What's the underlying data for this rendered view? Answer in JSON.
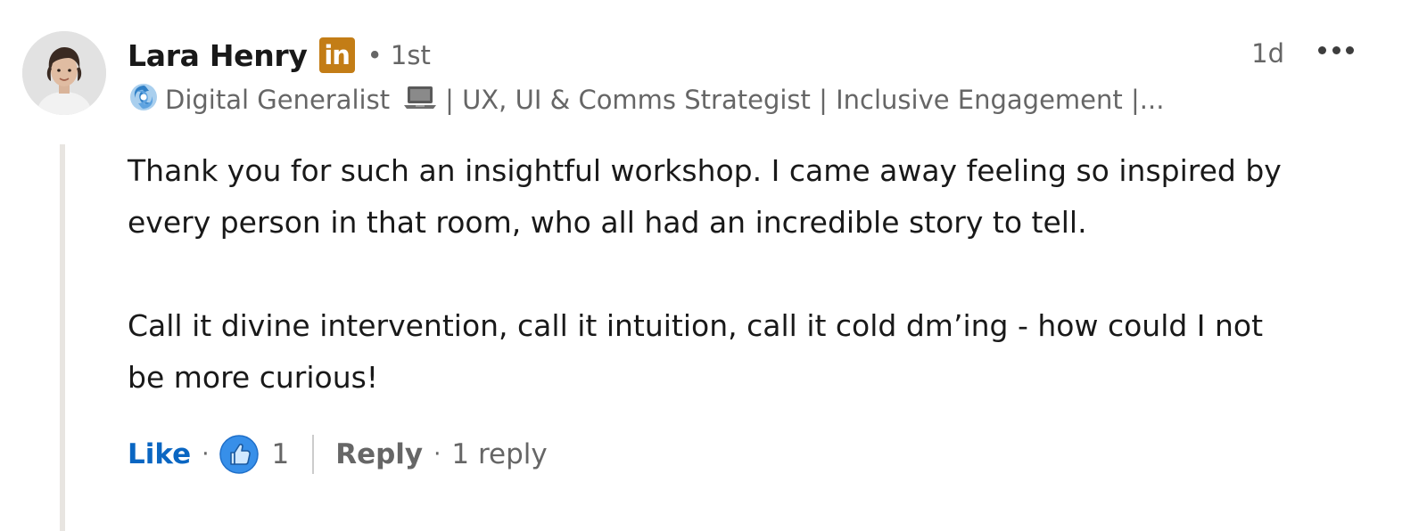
{
  "comment": {
    "author": {
      "name": "Lara Henry",
      "badge_text": "in",
      "connection_degree": "• 1st",
      "headline_start": "Digital Generalist",
      "headline_rest": "| UX, UI & Comms Strategist | Inclusive Engagement |..."
    },
    "timestamp": "1d",
    "body": {
      "paragraph_1_line_1": "Thank you for such an insightful workshop. I came away feeling so inspired by",
      "paragraph_1_line_2": "every person in that room, who all had an incredible story to tell.",
      "paragraph_2_line_1": "Call it divine intervention, call it intuition, call it cold dm’ing - how could I not",
      "paragraph_2_line_2": "be more curious!"
    },
    "actions": {
      "like_label": "Like",
      "separator": "·",
      "like_count": "1",
      "reply_label": "Reply",
      "replies_text": "1 reply"
    }
  },
  "icons": {
    "badge": "linkedin-badge-icon",
    "headline_emoji_1": "hurricane-icon",
    "headline_emoji_2": "laptop-icon",
    "more": "more-options-icon",
    "reaction": "thumbs-up-icon"
  },
  "colors": {
    "like_blue": "#0a66c2",
    "badge_gold": "#c37d16",
    "secondary_text": "#666666",
    "primary_text": "#191919",
    "thread_line": "#e8e5e1"
  }
}
